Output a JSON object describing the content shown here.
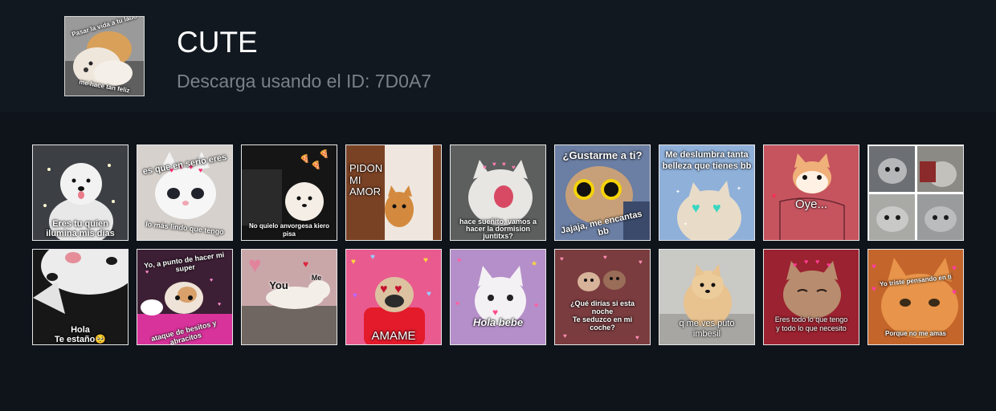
{
  "pack": {
    "title": "CUTE",
    "subtitle": "Descarga usando el ID: 7D0A7",
    "cover": {
      "icon": "sticker-puppies",
      "top_text": "Pasar la vida a tu lado",
      "bottom_text": "me hace tan feliz"
    }
  },
  "stickers": [
    {
      "icon": "sticker-white-dog",
      "texts": [
        "Eres tu quien",
        "ilumina mis dias"
      ]
    },
    {
      "icon": "sticker-white-kitten-hearts",
      "texts": [
        "es que en serio eres",
        "lo más lindo que tengo"
      ]
    },
    {
      "icon": "sticker-puppy-car",
      "texts": [
        "No quielo anvorgesa kiero pisa"
      ]
    },
    {
      "icon": "sticker-cat-door",
      "texts": [
        "PIDON",
        "MI AMOR"
      ]
    },
    {
      "icon": "sticker-yawning-cat",
      "texts": [
        "hace sueñito, vamos a",
        "hacer la dormision",
        "juntitxs?"
      ]
    },
    {
      "icon": "sticker-cat-sunglasses",
      "texts": [
        "¿Gustarme a ti?",
        "Jajaja, me encantas bb"
      ]
    },
    {
      "icon": "sticker-cat-heart-glasses",
      "texts": [
        "Me deslumbra tanta",
        "belleza que tienes bb"
      ]
    },
    {
      "icon": "sticker-cat-drawing",
      "texts": [
        "Oye..."
      ]
    },
    {
      "icon": "sticker-four-cats",
      "texts": []
    },
    {
      "icon": "sticker-cat-closeup",
      "texts": [
        "Hola",
        "Te estaño🥺"
      ]
    },
    {
      "icon": "sticker-kitten-pink",
      "texts": [
        "Yo, a punto de hacer mi super",
        "ataque de besitos y abracitos"
      ]
    },
    {
      "icon": "sticker-cat-lying",
      "texts": [
        "You",
        "Me"
      ]
    },
    {
      "icon": "sticker-pug-hoodie",
      "texts": [
        "AMAME"
      ]
    },
    {
      "icon": "sticker-white-cat-hearts",
      "texts": [
        "Hola bebe"
      ]
    },
    {
      "icon": "sticker-chihuahuas",
      "texts": [
        "¿Qué dirías si esta",
        "noche",
        "Te seduzco en mi",
        "coche?"
      ]
    },
    {
      "icon": "sticker-pomeranian",
      "texts": [
        "q me ves puto",
        "imbesil"
      ]
    },
    {
      "icon": "sticker-tabby-hearts",
      "texts": [
        "Eres todo lo que tengo",
        "y todo lo que necesito"
      ]
    },
    {
      "icon": "sticker-orange-cat",
      "texts": [
        "Yo triste pensando en ti",
        "Porque no me amas"
      ]
    }
  ],
  "colors": {
    "background": "#0f141b",
    "header": "#111820",
    "title": "#ffffff",
    "subtitle": "#7c8087"
  }
}
